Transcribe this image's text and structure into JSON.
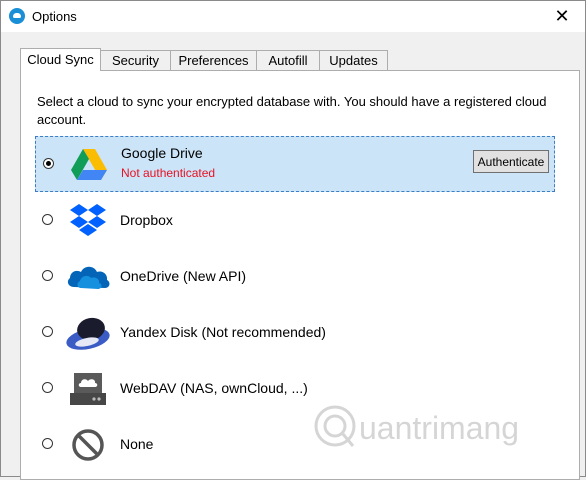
{
  "window": {
    "title": "Options",
    "app_icon": "cloud-icon",
    "close_glyph": "✕"
  },
  "tabs": [
    {
      "label": "Cloud Sync",
      "active": true
    },
    {
      "label": "Security",
      "active": false
    },
    {
      "label": "Preferences",
      "active": false
    },
    {
      "label": "Autofill",
      "active": false
    },
    {
      "label": "Updates",
      "active": false
    }
  ],
  "cloud_sync": {
    "intro": "Select a cloud to sync your encrypted database with. You should have a registered cloud account.",
    "providers": [
      {
        "name": "Google Drive",
        "status": "Not authenticated",
        "selected": true,
        "icon": "google-drive-icon",
        "action": "Authenticate"
      },
      {
        "name": "Dropbox",
        "selected": false,
        "icon": "dropbox-icon"
      },
      {
        "name": "OneDrive (New API)",
        "selected": false,
        "icon": "onedrive-icon"
      },
      {
        "name": "Yandex Disk (Not recommended)",
        "selected": false,
        "icon": "yandex-disk-icon"
      },
      {
        "name": "WebDAV (NAS, ownCloud, ...)",
        "selected": false,
        "icon": "webdav-icon"
      },
      {
        "name": "None",
        "selected": false,
        "icon": "none-icon"
      }
    ]
  },
  "watermark": {
    "text": "uantrimang",
    "icon": "quantrimang-logo"
  },
  "colors": {
    "selection_bg": "#cce4f7",
    "selection_border": "#3b7ec3",
    "error_text": "#e81123"
  }
}
